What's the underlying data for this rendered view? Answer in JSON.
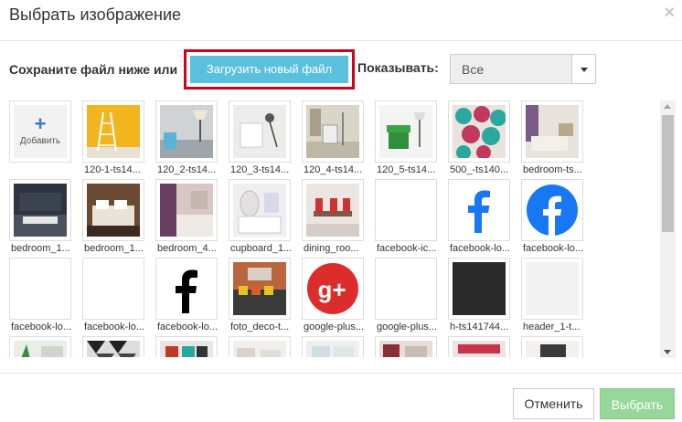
{
  "dialog": {
    "title": "Выбрать изображение",
    "close_symbol": "×"
  },
  "toolbar": {
    "save_label": "Сохраните файл ниже или",
    "upload_button": "Загрузить новый файл",
    "show_label": "Показывать:",
    "filter_value": "Все"
  },
  "gallery": {
    "add_label": "Добавить",
    "items": [
      "120-1-ts14...",
      "120_2-ts14...",
      "120_3-ts14...",
      "120_4-ts14...",
      "120_5-ts14...",
      "500_-ts140...",
      "bedroom-ts...",
      "bedroom_1...",
      "bedroom_1...",
      "bedroom_4...",
      "cupboard_1...",
      "dining_roo...",
      "facebook-ic...",
      "facebook-lo...",
      "facebook-lo...",
      "facebook-lo...",
      "facebook-lo...",
      "facebook-lo...",
      "foto_deco-t...",
      "google-plus...",
      "google-plus...",
      "h-ts141744...",
      "header_1-t..."
    ]
  },
  "footer": {
    "cancel_label": "Отменить",
    "select_label": "Выбрать"
  },
  "colors": {
    "upload_button": "#5bc0de",
    "highlight_border": "#d0021b",
    "select_button": "#98d79a",
    "facebook_blue": "#1877f2",
    "google_red": "#dd2c2c"
  }
}
